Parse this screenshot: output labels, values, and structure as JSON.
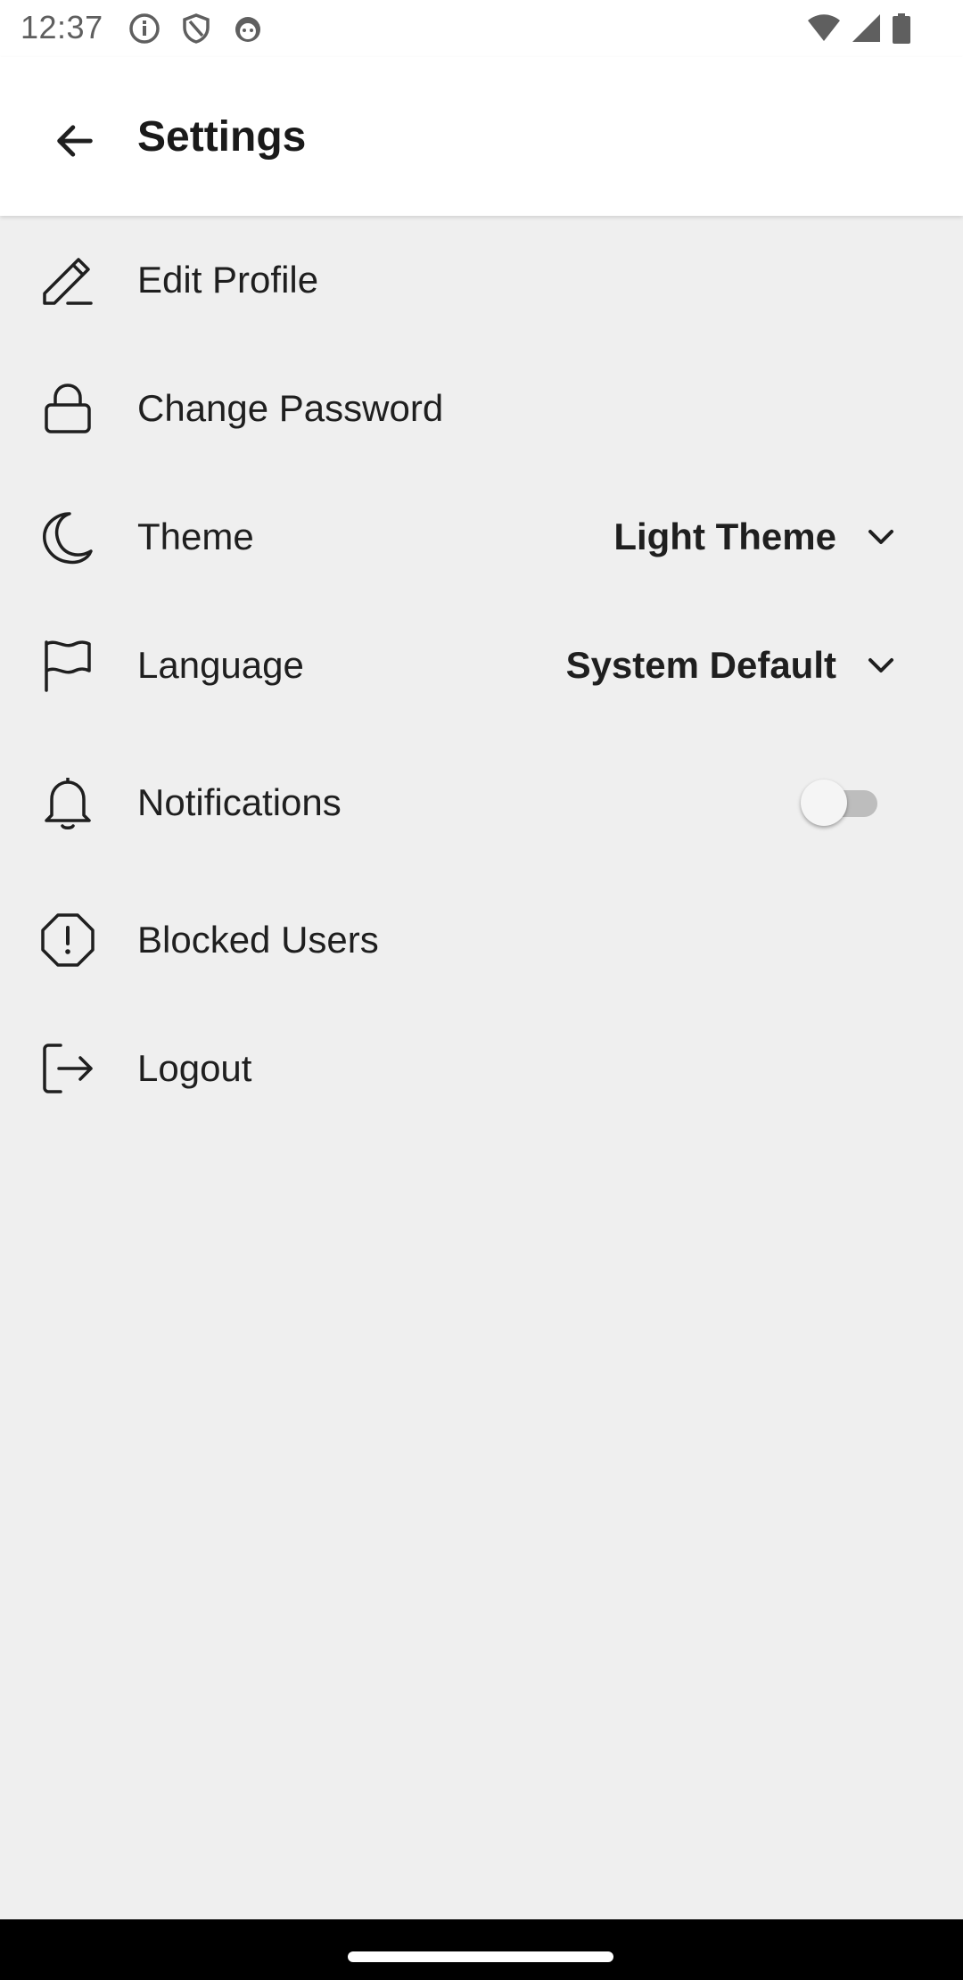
{
  "status_bar": {
    "time": "12:37",
    "left_icons": [
      "info-icon",
      "shield-icon",
      "android-icon"
    ],
    "right_icons": [
      "wifi-icon",
      "signal-icon",
      "battery-icon"
    ]
  },
  "header": {
    "title": "Settings",
    "back_icon": "arrow-back-icon"
  },
  "settings": {
    "items": [
      {
        "label": "Edit Profile",
        "icon": "pencil-icon"
      },
      {
        "label": "Change Password",
        "icon": "lock-icon"
      },
      {
        "label": "Theme",
        "icon": "moon-icon",
        "value": "Light Theme"
      },
      {
        "label": "Language",
        "icon": "flag-icon",
        "value": "System Default"
      },
      {
        "label": "Notifications",
        "icon": "bell-icon",
        "toggle_on": false
      },
      {
        "label": "Blocked Users",
        "icon": "octagon-alert-icon"
      },
      {
        "label": "Logout",
        "icon": "logout-icon"
      }
    ]
  },
  "colors": {
    "background": "#efefef",
    "surface": "#ffffff",
    "text": "#1f1f1f",
    "toggle_track_off": "#bdbdbd",
    "nav_bar": "#000000"
  }
}
